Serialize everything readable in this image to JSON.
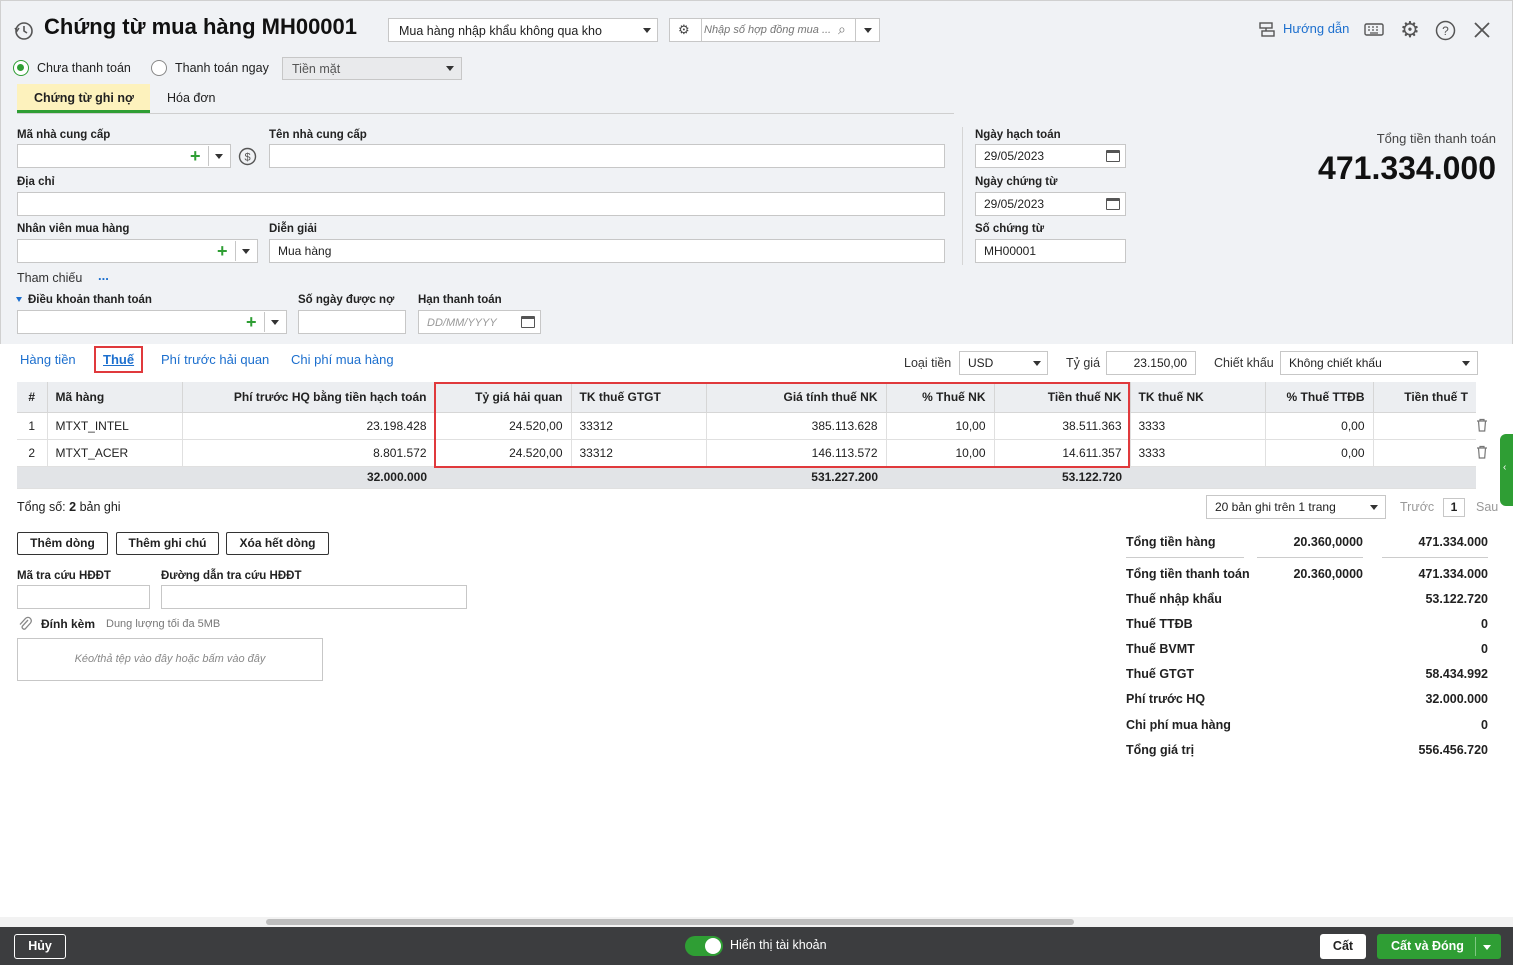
{
  "header": {
    "title": "Chứng từ mua hàng MH00001",
    "voucher_type": "Mua hàng nhập khẩu không qua kho",
    "contract_placeholder": "Nhập số hợp đồng mua ...",
    "help_label": "Hướng dẫn"
  },
  "payment": {
    "unpaid_label": "Chưa thanh toán",
    "paid_now_label": "Thanh toán ngay",
    "method": "Tiền mặt"
  },
  "doc_tabs": [
    "Chứng từ ghi nợ",
    "Hóa đơn"
  ],
  "form": {
    "supplier_code_label": "Mã nhà cung cấp",
    "supplier_code": "",
    "supplier_name_label": "Tên nhà cung cấp",
    "supplier_name": "",
    "address_label": "Địa chỉ",
    "address": "",
    "buyer_label": "Nhân viên mua hàng",
    "buyer": "",
    "description_label": "Diễn giải",
    "description": "Mua hàng",
    "reference_label": "Tham chiếu",
    "reference_more": "...",
    "payment_terms_label": "Điều khoản thanh toán",
    "credit_days_label": "Số ngày được nợ",
    "due_date_label": "Hạn thanh toán",
    "due_date_placeholder": "DD/MM/YYYY",
    "posting_date_label": "Ngày hạch toán",
    "posting_date": "29/05/2023",
    "voucher_date_label": "Ngày chứng từ",
    "voucher_date": "29/05/2023",
    "voucher_no_label": "Số chứng từ",
    "voucher_no": "MH00001"
  },
  "total": {
    "label": "Tổng tiền thanh toán",
    "value": "471.334.000"
  },
  "detail_tabs": [
    "Hàng tiền",
    "Thuế",
    "Phí trước hải quan",
    "Chi phí mua hàng"
  ],
  "currency": {
    "currency_label": "Loại tiền",
    "currency": "USD",
    "rate_label": "Tỷ giá",
    "rate": "23.150,00",
    "discount_label": "Chiết khấu",
    "discount": "Không chiết khấu"
  },
  "grid": {
    "columns": [
      "#",
      "Mã hàng",
      "Phí trước HQ bằng tiền hạch toán",
      "Tỷ giá hải quan",
      "TK thuế GTGT",
      "Giá tính thuế NK",
      "% Thuế NK",
      "Tiền thuế NK",
      "TK thuế NK",
      "% Thuế TTĐB",
      "Tiền thuế T"
    ],
    "rows": [
      [
        "1",
        "MTXT_INTEL",
        "23.198.428",
        "24.520,00",
        "33312",
        "385.113.628",
        "10,00",
        "38.511.363",
        "3333",
        "0,00",
        ""
      ],
      [
        "2",
        "MTXT_ACER",
        "8.801.572",
        "24.520,00",
        "33312",
        "146.113.572",
        "10,00",
        "14.611.357",
        "3333",
        "0,00",
        ""
      ]
    ],
    "footer": [
      "",
      "",
      "32.000.000",
      "",
      "",
      "531.227.200",
      "",
      "53.122.720",
      "",
      "",
      ""
    ]
  },
  "paging": {
    "count_prefix": "Tổng số:",
    "count": "2",
    "count_suffix": "bản ghi",
    "page_size": "20 bản ghi trên 1 trang",
    "prev": "Trước",
    "page": "1",
    "next": "Sau"
  },
  "actions": {
    "add_row": "Thêm dòng",
    "add_note": "Thêm ghi chú",
    "delete_all": "Xóa hết dòng"
  },
  "einvoice": {
    "lookup_code_label": "Mã tra cứu HĐĐT",
    "lookup_url_label": "Đường dẫn tra cứu HĐĐT"
  },
  "attach": {
    "label": "Đính kèm",
    "limit": "Dung lượng tối đa 5MB",
    "drop_hint": "Kéo/thả tệp vào đây hoặc bấm vào đây"
  },
  "summary": [
    {
      "label": "Tổng tiền hàng",
      "fc": "20.360,0000",
      "value": "471.334.000"
    },
    {
      "label": "Tổng tiền thanh toán",
      "fc": "20.360,0000",
      "value": "471.334.000"
    },
    {
      "label": "Thuế nhập khẩu",
      "fc": "",
      "value": "53.122.720"
    },
    {
      "label": "Thuế TTĐB",
      "fc": "",
      "value": "0"
    },
    {
      "label": "Thuế BVMT",
      "fc": "",
      "value": "0"
    },
    {
      "label": "Thuế GTGT",
      "fc": "",
      "value": "58.434.992"
    },
    {
      "label": "Phí trước HQ",
      "fc": "",
      "value": "32.000.000"
    },
    {
      "label": "Chi phí mua hàng",
      "fc": "",
      "value": "0"
    },
    {
      "label": "Tổng giá trị",
      "fc": "",
      "value": "556.456.720"
    }
  ],
  "footer": {
    "cancel": "Hủy",
    "show_accounts": "Hiển thị tài khoản",
    "save": "Cất",
    "save_close": "Cất và Đóng"
  },
  "colors": {
    "accent_green": "#2f9e34",
    "link_blue": "#1c6fce",
    "highlight_red": "#e0393c",
    "footer_bar": "#3c3d3f"
  }
}
